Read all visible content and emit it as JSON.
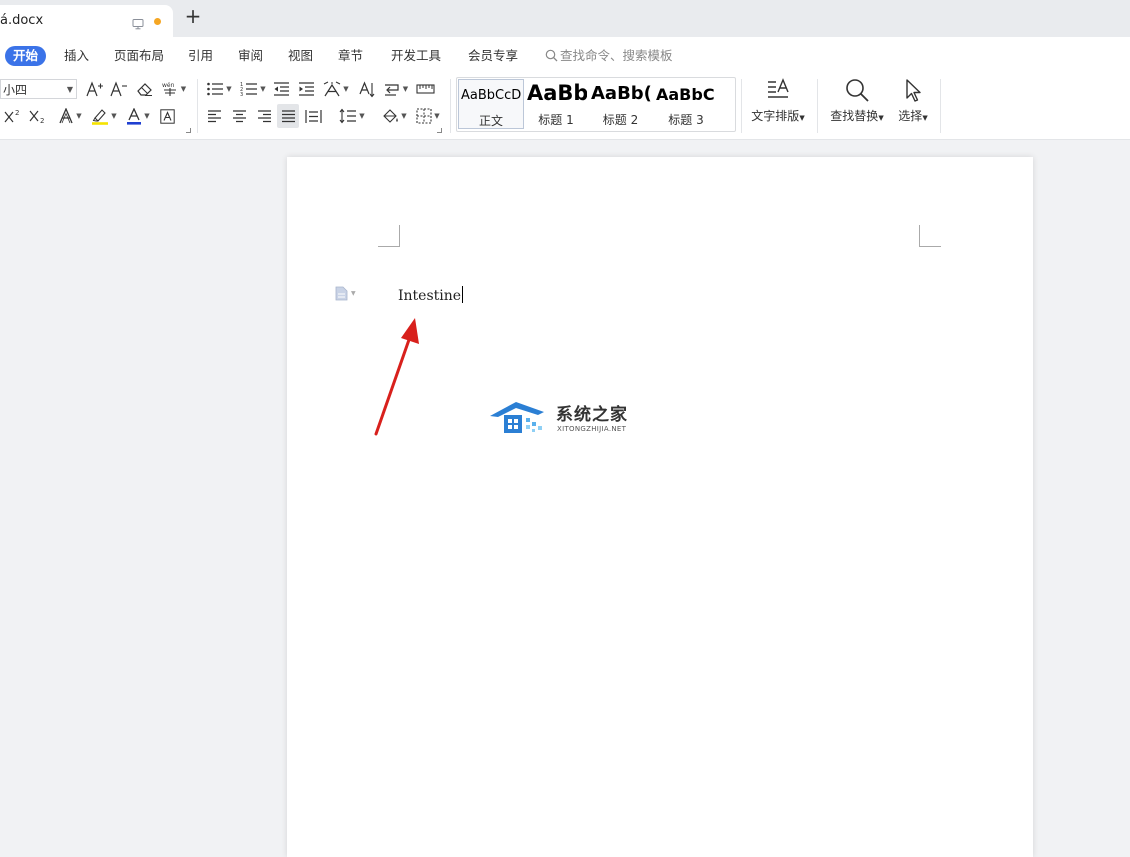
{
  "window": {
    "doc_tab_title": "á.docx",
    "new_tab_symbol": "+"
  },
  "menu": {
    "items": [
      "开始",
      "插入",
      "页面布局",
      "引用",
      "审阅",
      "视图",
      "章节",
      "开发工具",
      "会员专享"
    ],
    "active_index": 0,
    "search_placeholder": "查找命令、搜索模板"
  },
  "ribbon": {
    "font_size_value": "小四",
    "styles": [
      {
        "sample": "AaBbCcD",
        "name": "正文"
      },
      {
        "sample": "AaBb",
        "name": "标题 1"
      },
      {
        "sample": "AaBb(",
        "name": "标题 2"
      },
      {
        "sample": "AaBbC",
        "name": "标题 3"
      }
    ],
    "text_layout_label": "文字排版",
    "find_replace_label": "查找替换",
    "select_label": "选择",
    "font_color_accent": "#1f3fd1",
    "highlight_accent": "#f5e300"
  },
  "document": {
    "body_text": "Intestine"
  },
  "annotation": {
    "arrow_color": "#d8201c"
  },
  "watermark": {
    "name_cn": "系统之家",
    "name_en": "XITONGZHIJIA.NET"
  }
}
